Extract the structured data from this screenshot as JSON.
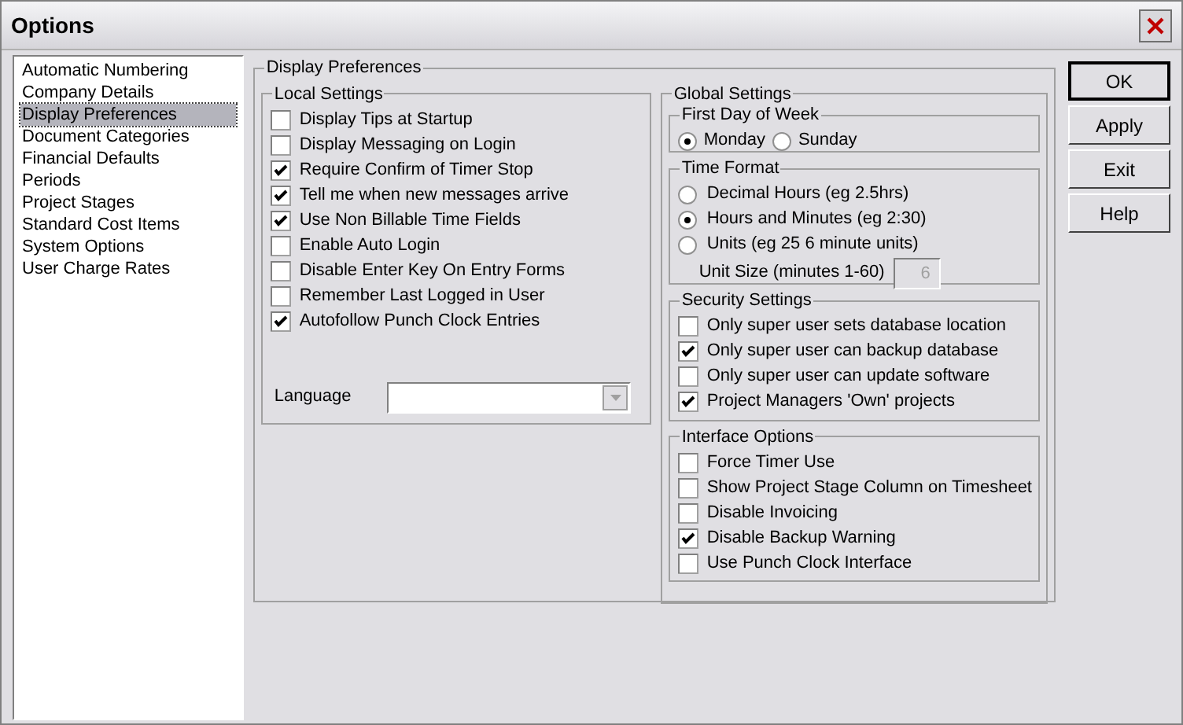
{
  "window": {
    "title": "Options"
  },
  "sidebar": {
    "items": [
      {
        "label": "Automatic Numbering",
        "selected": false
      },
      {
        "label": "Company Details",
        "selected": false
      },
      {
        "label": "Display Preferences",
        "selected": true
      },
      {
        "label": "Document Categories",
        "selected": false
      },
      {
        "label": "Financial Defaults",
        "selected": false
      },
      {
        "label": "Periods",
        "selected": false
      },
      {
        "label": "Project Stages",
        "selected": false
      },
      {
        "label": "Standard Cost Items",
        "selected": false
      },
      {
        "label": "System Options",
        "selected": false
      },
      {
        "label": "User Charge Rates",
        "selected": false
      }
    ]
  },
  "panel": {
    "title": "Display Preferences",
    "local_settings": {
      "title": "Local Settings",
      "options": [
        {
          "label": "Display Tips at Startup",
          "checked": false
        },
        {
          "label": "Display Messaging on Login",
          "checked": false
        },
        {
          "label": "Require Confirm of Timer Stop",
          "checked": true
        },
        {
          "label": "Tell me when new messages arrive",
          "checked": true
        },
        {
          "label": "Use Non Billable Time Fields",
          "checked": true
        },
        {
          "label": "Enable Auto Login",
          "checked": false
        },
        {
          "label": "Disable Enter Key On Entry Forms",
          "checked": false
        },
        {
          "label": "Remember Last Logged in User",
          "checked": false
        },
        {
          "label": "Autofollow Punch Clock Entries",
          "checked": true
        }
      ],
      "language": {
        "label": "Language",
        "disabled": true
      }
    },
    "global_settings": {
      "title": "Global Settings",
      "first_day_of_week": {
        "title": "First Day of Week",
        "options": [
          {
            "label": "Monday",
            "selected": true
          },
          {
            "label": "Sunday",
            "selected": false
          }
        ]
      },
      "time_format": {
        "title": "Time Format",
        "options": [
          {
            "label": "Decimal Hours (eg 2.5hrs)",
            "selected": false
          },
          {
            "label": "Hours and Minutes (eg 2:30)",
            "selected": true
          },
          {
            "label": "Units (eg 25 6 minute units)",
            "selected": false
          }
        ],
        "unit_size": {
          "label": "Unit Size (minutes 1-60)",
          "value": "6",
          "disabled": true
        }
      },
      "security_settings": {
        "title": "Security Settings",
        "options": [
          {
            "label": "Only super user sets database location",
            "checked": false
          },
          {
            "label": "Only super user can backup database",
            "checked": true
          },
          {
            "label": "Only super user can update software",
            "checked": false
          },
          {
            "label": "Project Managers 'Own' projects",
            "checked": true
          }
        ]
      },
      "interface_options": {
        "title": "Interface Options",
        "options": [
          {
            "label": "Force Timer Use",
            "checked": false
          },
          {
            "label": "Show Project Stage Column on Timesheet",
            "checked": false
          },
          {
            "label": "Disable Invoicing",
            "checked": false
          },
          {
            "label": "Disable Backup Warning",
            "checked": true
          },
          {
            "label": "Use Punch Clock Interface",
            "checked": false
          }
        ]
      }
    }
  },
  "buttons": [
    {
      "label": "OK",
      "default": true
    },
    {
      "label": "Apply",
      "default": false
    },
    {
      "label": "Exit",
      "default": false
    },
    {
      "label": "Help",
      "default": false
    }
  ]
}
